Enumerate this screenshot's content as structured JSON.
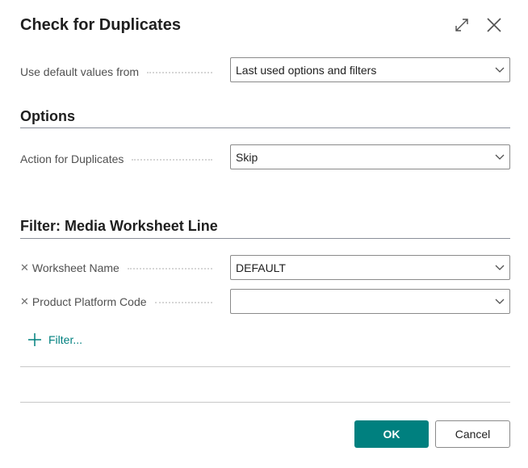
{
  "dialog": {
    "title": "Check for Duplicates"
  },
  "defaults": {
    "label": "Use default values from",
    "value": "Last used options and filters"
  },
  "options": {
    "heading": "Options",
    "action_label": "Action for Duplicates",
    "action_value": "Skip"
  },
  "filter": {
    "heading": "Filter: Media Worksheet Line",
    "rows": [
      {
        "label": "Worksheet Name",
        "value": "DEFAULT"
      },
      {
        "label": "Product Platform Code",
        "value": ""
      }
    ],
    "add_label": "Filter..."
  },
  "footer": {
    "ok": "OK",
    "cancel": "Cancel"
  },
  "colors": {
    "accent": "#00807f"
  }
}
